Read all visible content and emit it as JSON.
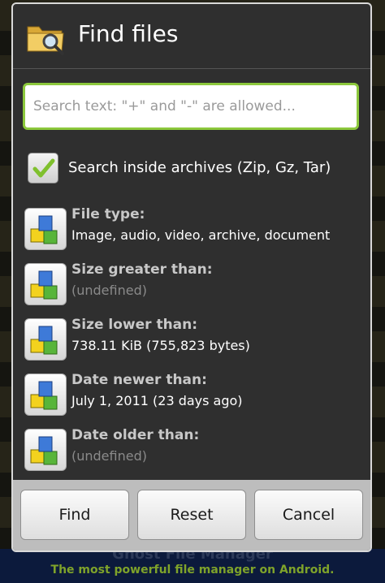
{
  "background_app": {
    "footer_title": "Ghost File Manager",
    "footer_subtitle": "The most powerful file manager on Android."
  },
  "dialog": {
    "title": "Find files",
    "title_icon": "folder-search-icon",
    "search": {
      "value": "",
      "placeholder": "Search text: \"+\" and \"-\" are allowed..."
    },
    "archives_checkbox": {
      "label": "Search inside archives (Zip, Gz, Tar)",
      "checked": true
    },
    "filters": [
      {
        "label": "File type:",
        "value": "Image, audio, video, archive, document",
        "defined": true
      },
      {
        "label": "Size greater than:",
        "value": "(undefined)",
        "defined": false
      },
      {
        "label": "Size lower than:",
        "value": "738.11 KiB (755,823 bytes)",
        "defined": true
      },
      {
        "label": "Date newer than:",
        "value": "July 1, 2011 (23 days ago)",
        "defined": true
      },
      {
        "label": "Date older than:",
        "value": "(undefined)",
        "defined": false
      }
    ],
    "filter_icon": "blocks-icon",
    "buttons": {
      "find": "Find",
      "reset": "Reset",
      "cancel": "Cancel"
    }
  },
  "colors": {
    "accent_green": "#8cc83c",
    "dialog_bg": "#2f2f2f",
    "button_bar_bg": "#bdbdbd"
  }
}
